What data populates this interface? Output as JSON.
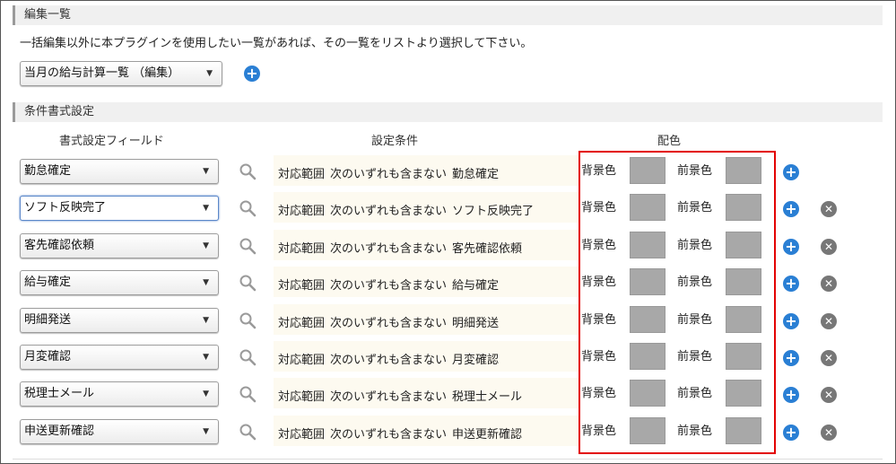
{
  "list_section": {
    "title": "編集一覧",
    "description": "一括編集以外に本プラグインを使用したい一覧があれば、その一覧をリストより選択して下さい。",
    "selected_view": "当月の給与計算一覧 （編集）"
  },
  "cond_section": {
    "title": "条件書式設定",
    "columns": {
      "field": "書式設定フィールド",
      "condition": "設定条件",
      "color": "配色"
    },
    "scope_label": "対応範囲",
    "operator": "次のいずれも含まない",
    "bg_label": "背景色",
    "fg_label": "前景色",
    "rows": [
      {
        "field": "勤怠確定",
        "value": "勤怠確定"
      },
      {
        "field": "ソフト反映完了",
        "value": "ソフト反映完了"
      },
      {
        "field": "客先確認依頼",
        "value": "客先確認依頼"
      },
      {
        "field": "給与確定",
        "value": "給与確定"
      },
      {
        "field": "明細発送",
        "value": "明細発送"
      },
      {
        "field": "月変確認",
        "value": "月変確認"
      },
      {
        "field": "税理士メール",
        "value": "税理士メール"
      },
      {
        "field": "申送更新確認",
        "value": "申送更新確認"
      }
    ]
  },
  "colors": {
    "accent": "#2a7fd4",
    "swatch": "#a8a8a8",
    "highlight": "#e30000"
  }
}
